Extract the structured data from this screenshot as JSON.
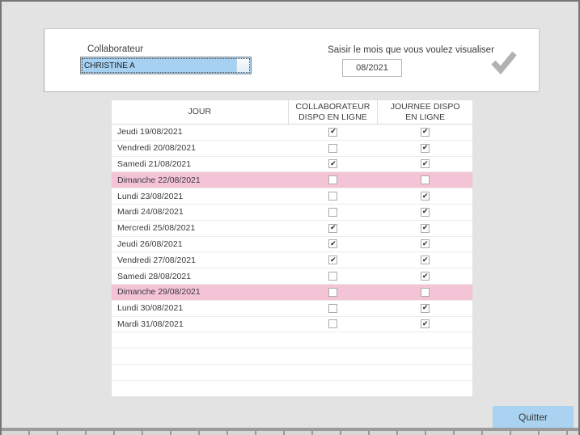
{
  "top_panel": {
    "collaborateur_label": "Collaborateur",
    "collaborateur_value": "CHRISTINE A",
    "month_prompt": "Saisir le mois que vous voulez visualiser",
    "month_value": "08/2021"
  },
  "table": {
    "headers": [
      "JOUR",
      "COLLABORATEUR\nDISPO EN LIGNE",
      "JOURNEE DISPO\nEN LIGNE"
    ],
    "rows": [
      {
        "day": "Jeudi 19/08/2021",
        "collab_dispo": true,
        "journee_dispo": true,
        "highlight": false
      },
      {
        "day": "Vendredi 20/08/2021",
        "collab_dispo": false,
        "journee_dispo": true,
        "highlight": false
      },
      {
        "day": "Samedi 21/08/2021",
        "collab_dispo": true,
        "journee_dispo": true,
        "highlight": false
      },
      {
        "day": "Dimanche 22/08/2021",
        "collab_dispo": false,
        "journee_dispo": false,
        "highlight": true
      },
      {
        "day": "Lundi 23/08/2021",
        "collab_dispo": false,
        "journee_dispo": true,
        "highlight": false
      },
      {
        "day": "Mardi 24/08/2021",
        "collab_dispo": false,
        "journee_dispo": true,
        "highlight": false
      },
      {
        "day": "Mercredi 25/08/2021",
        "collab_dispo": true,
        "journee_dispo": true,
        "highlight": false
      },
      {
        "day": "Jeudi 26/08/2021",
        "collab_dispo": true,
        "journee_dispo": true,
        "highlight": false
      },
      {
        "day": "Vendredi 27/08/2021",
        "collab_dispo": true,
        "journee_dispo": true,
        "highlight": false
      },
      {
        "day": "Samedi 28/08/2021",
        "collab_dispo": false,
        "journee_dispo": true,
        "highlight": false
      },
      {
        "day": "Dimanche 29/08/2021",
        "collab_dispo": false,
        "journee_dispo": false,
        "highlight": true
      },
      {
        "day": "Lundi 30/08/2021",
        "collab_dispo": false,
        "journee_dispo": true,
        "highlight": false
      },
      {
        "day": "Mardi 31/08/2021",
        "collab_dispo": false,
        "journee_dispo": true,
        "highlight": false
      }
    ],
    "empty_row_count": 4
  },
  "footer": {
    "quit_label": "Quitter"
  },
  "icons": {
    "confirm": "checkmark-icon",
    "combobox_dropdown": "dropdown-button"
  },
  "colors": {
    "window_bg": "#e3e3e3",
    "selection_blue": "#a6d1f2",
    "sunday_pink": "#f4c3d6",
    "button_blue": "#a9d3f0",
    "check_icon_gray": "#b3b0b0"
  }
}
